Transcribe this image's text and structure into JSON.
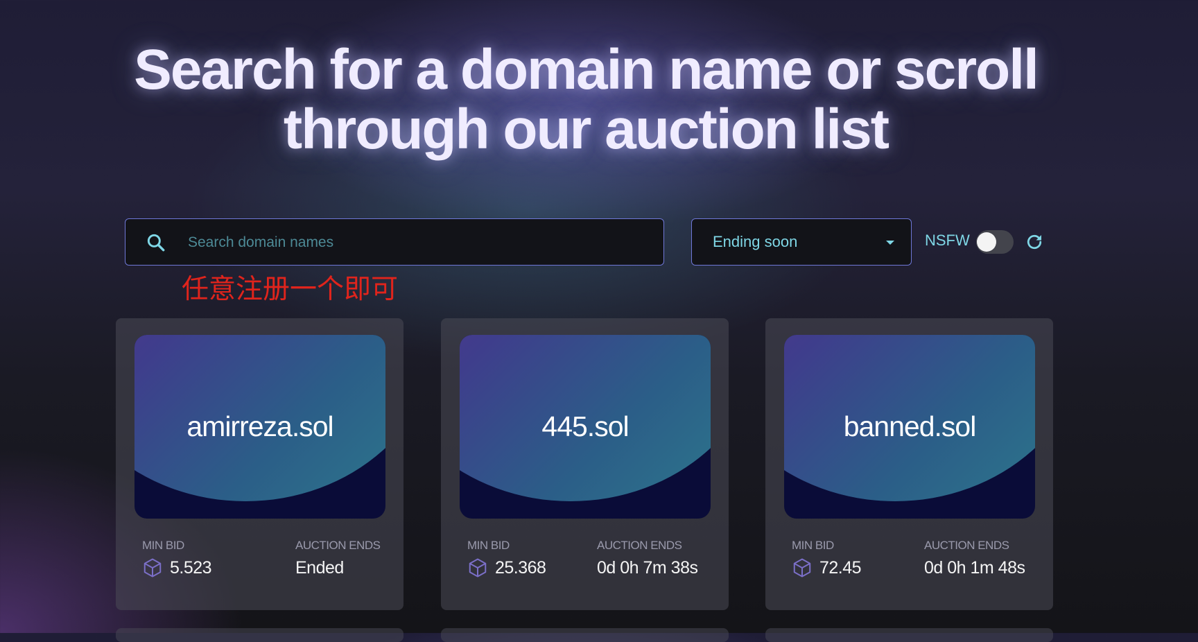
{
  "hero": {
    "title_line1": "Search for a domain name or scroll",
    "title_line2": "through our auction list"
  },
  "search": {
    "placeholder": "Search domain names",
    "value": ""
  },
  "sort": {
    "selected": "Ending soon"
  },
  "nsfw": {
    "label": "NSFW",
    "enabled": false
  },
  "annotation": {
    "text": "任意注册一个即可"
  },
  "cards": [
    {
      "domain": "amirreza.sol",
      "min_bid_label": "MIN BID",
      "min_bid": "5.523",
      "ends_label": "AUCTION ENDS",
      "ends": "Ended"
    },
    {
      "domain": "445.sol",
      "min_bid_label": "MIN BID",
      "min_bid": "25.368",
      "ends_label": "AUCTION ENDS",
      "ends": "0d 0h 7m 38s"
    },
    {
      "domain": "banned.sol",
      "min_bid_label": "MIN BID",
      "min_bid": "72.45",
      "ends_label": "AUCTION ENDS",
      "ends": "0d 0h 1m 48s"
    }
  ],
  "colors": {
    "accent": "#7fd7e6",
    "border": "#6f78d8",
    "annotation": "#e0241c"
  },
  "icons": [
    "search-icon",
    "chevron-down-icon",
    "refresh-icon",
    "solana-cube-icon"
  ]
}
